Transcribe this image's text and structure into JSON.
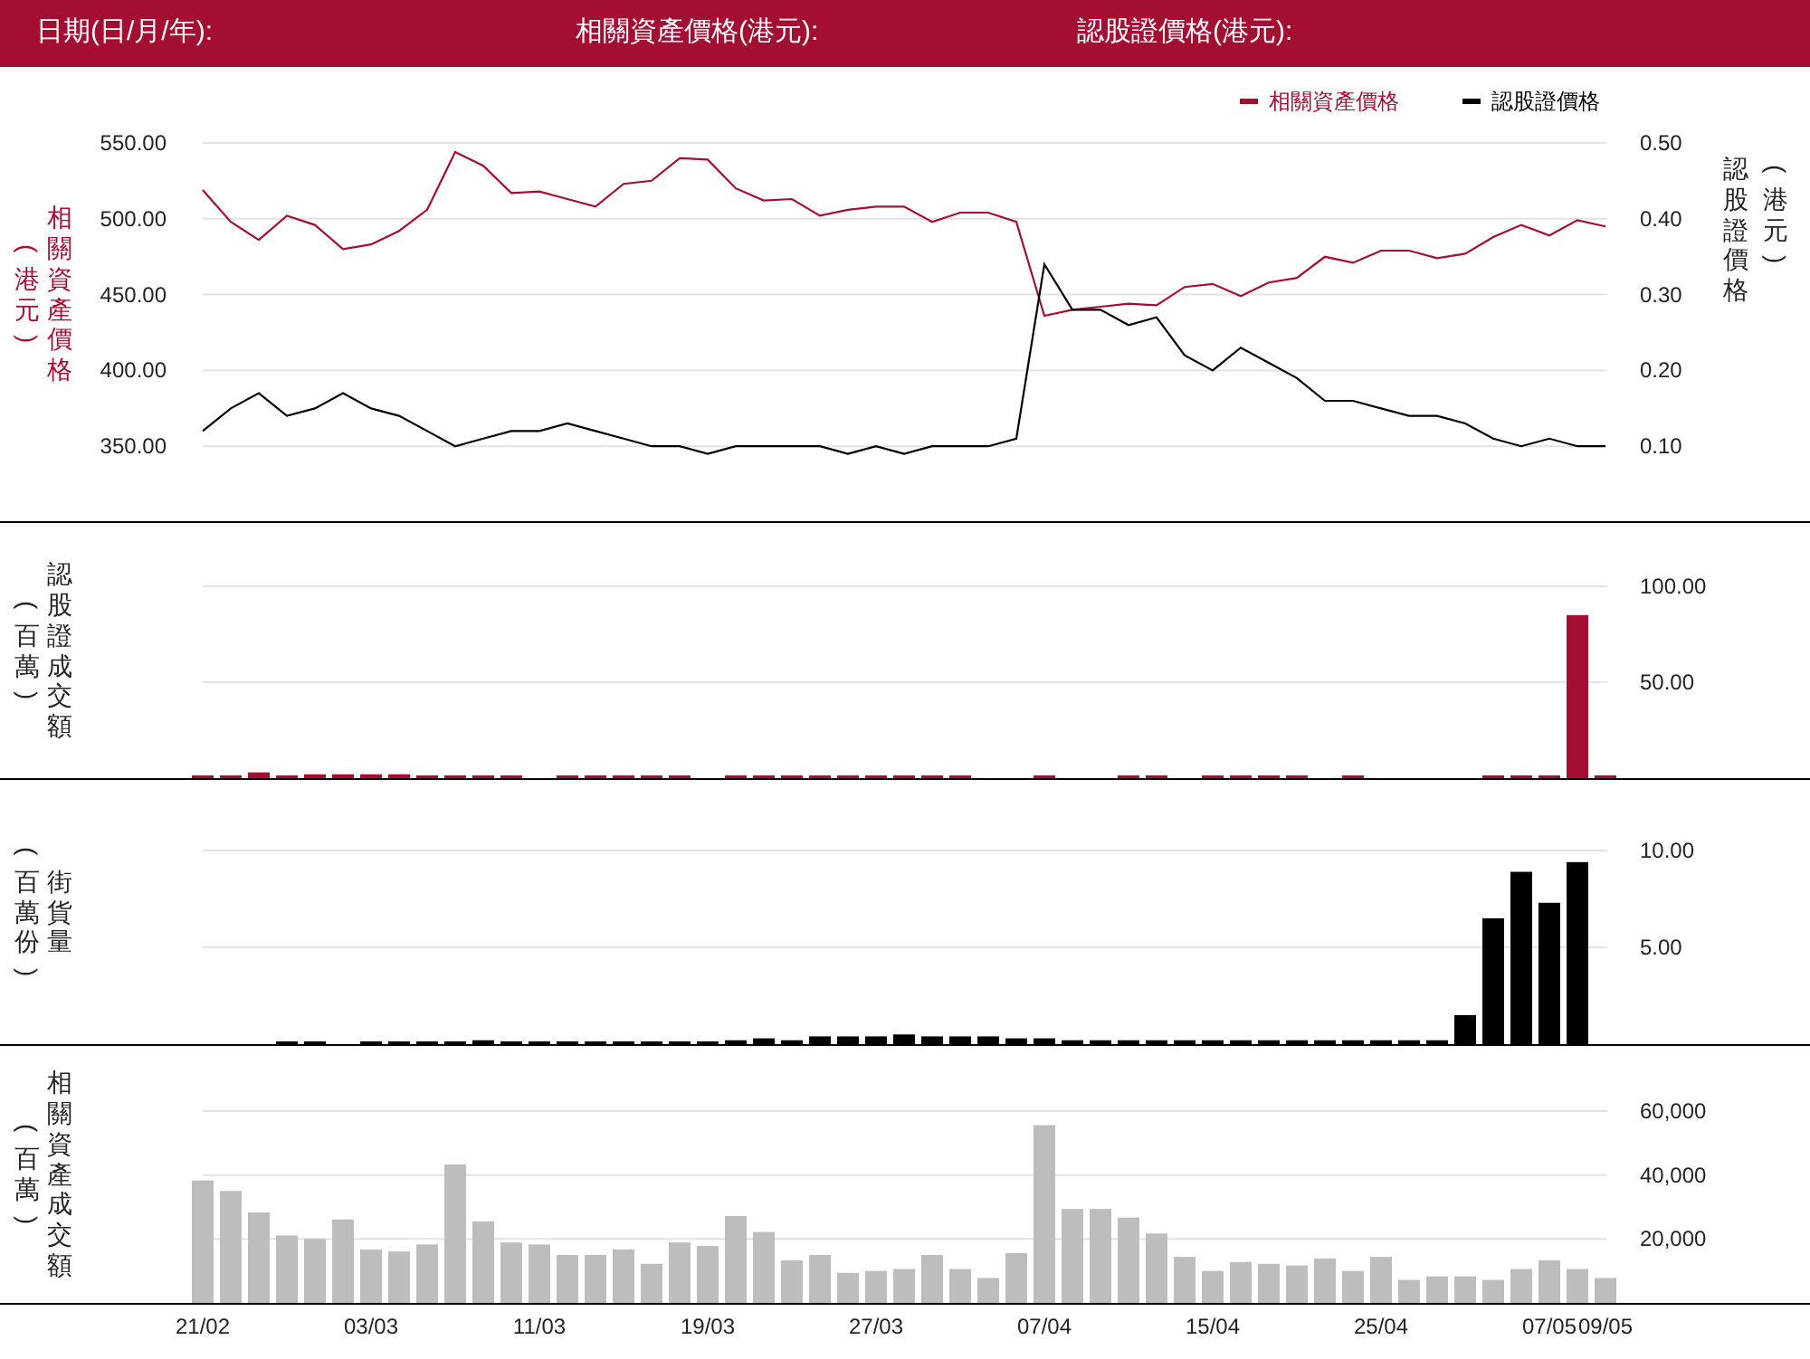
{
  "header": {
    "fields": [
      "日期(日/月/年):",
      "相關資產價格(港元):",
      "認股證價格(港元):"
    ]
  },
  "price_panel": {
    "left_unit": "(港元)",
    "right_axis_title": "認股證價格",
    "right_unit": "(港元)",
    "underlying_chart": {
      "chart_data": {
        "type": "line",
        "ylabel": "相關資產價格",
        "grid": true,
        "ylim": [
          300,
          550
        ],
        "legend": "top-right",
        "yticks": [
          {
            "value": 550,
            "label": "550.00"
          },
          {
            "value": 500,
            "label": "500.00"
          },
          {
            "value": 450,
            "label": "450.00"
          },
          {
            "value": 400,
            "label": "400.00"
          },
          {
            "value": 350,
            "label": "350.00"
          }
        ],
        "series": [
          {
            "name": "相關資產價格",
            "color": "#a50e33",
            "values": [
              519,
              498,
              486,
              502,
              496,
              480,
              483,
              492,
              506,
              544,
              535,
              517,
              518,
              513,
              508,
              523,
              525,
              540,
              539,
              520,
              512,
              513,
              502,
              506,
              508,
              508,
              498,
              504,
              504,
              498,
              436,
              440,
              442,
              444,
              443,
              455,
              457,
              449,
              458,
              461,
              475,
              471,
              479,
              479,
              474,
              477,
              488,
              496,
              489,
              499,
              495
            ]
          }
        ]
      }
    },
    "warrant_chart": {
      "chart_data": {
        "type": "line",
        "legend": "top-right",
        "ylim": [
          0,
          0.5
        ],
        "yticks": [
          {
            "value": 0.5,
            "label": "0.50"
          },
          {
            "value": 0.4,
            "label": "0.40"
          },
          {
            "value": 0.3,
            "label": "0.30"
          },
          {
            "value": 0.2,
            "label": "0.20"
          },
          {
            "value": 0.1,
            "label": "0.10"
          }
        ],
        "series": [
          {
            "name": "認股證價格",
            "color": "#000000",
            "values": [
              0.12,
              0.15,
              0.17,
              0.14,
              0.15,
              0.17,
              0.15,
              0.14,
              0.12,
              0.1,
              0.11,
              0.12,
              0.12,
              0.13,
              0.12,
              0.11,
              0.1,
              0.1,
              0.09,
              0.1,
              0.1,
              0.1,
              0.1,
              0.09,
              0.1,
              0.09,
              0.1,
              0.1,
              0.1,
              0.11,
              0.34,
              0.28,
              0.28,
              0.26,
              0.27,
              0.22,
              0.2,
              0.23,
              0.21,
              0.19,
              0.16,
              0.16,
              0.15,
              0.14,
              0.14,
              0.13,
              0.11,
              0.1,
              0.11,
              0.1,
              0.1
            ]
          }
        ]
      }
    }
  },
  "warrant_turnover_panel": {
    "left_unit": "(百萬)",
    "chart_data": {
      "type": "bar",
      "ylabel": "認股證成交額",
      "grid": true,
      "ylim": [
        0,
        100
      ],
      "yticks": [
        {
          "value": 100,
          "label": "100.00"
        },
        {
          "value": 50,
          "label": "50.00"
        }
      ],
      "series": [
        {
          "color": "#a50e33",
          "values": [
            1,
            1,
            3,
            1,
            2,
            2,
            2,
            2,
            1,
            1,
            1,
            1,
            null,
            1,
            1,
            1,
            1,
            1,
            null,
            1,
            1,
            1,
            1,
            1,
            1,
            1,
            1,
            1,
            null,
            null,
            1,
            null,
            null,
            1,
            1,
            null,
            1,
            1,
            1,
            1,
            null,
            1,
            null,
            null,
            null,
            null,
            1,
            1,
            1,
            85,
            1
          ]
        }
      ]
    }
  },
  "outstanding_panel": {
    "left_unit": "(百萬份)",
    "chart_data": {
      "type": "bar",
      "ylabel": "街貨量",
      "grid": true,
      "ylim": [
        0,
        10
      ],
      "yticks": [
        {
          "value": 10,
          "label": "10.00"
        },
        {
          "value": 5,
          "label": "5.00"
        }
      ],
      "series": [
        {
          "color": "#000000",
          "values": [
            null,
            null,
            null,
            0.1,
            0.1,
            null,
            0.1,
            0.1,
            0.1,
            0.1,
            0.2,
            0.1,
            0.1,
            0.1,
            0.1,
            0.1,
            0.1,
            0.1,
            0.1,
            0.2,
            0.3,
            0.2,
            0.4,
            0.4,
            0.4,
            0.5,
            0.4,
            0.4,
            0.4,
            0.3,
            0.3,
            0.2,
            0.2,
            0.2,
            0.2,
            0.2,
            0.2,
            0.2,
            0.2,
            0.2,
            0.2,
            0.2,
            0.2,
            0.2,
            0.2,
            1.5,
            6.5,
            8.9,
            7.3,
            9.4,
            null
          ]
        }
      ]
    }
  },
  "underlying_turnover_panel": {
    "left_unit": "(百萬)",
    "chart_data": {
      "type": "bar",
      "ylabel": "相關資產成交額",
      "grid": true,
      "ylim": [
        0,
        60000
      ],
      "yticks": [
        {
          "value": 60000,
          "label": "60,000"
        },
        {
          "value": 40000,
          "label": "40,000"
        },
        {
          "value": 20000,
          "label": "20,000"
        }
      ],
      "categories": [
        "21/02",
        null,
        null,
        null,
        null,
        null,
        "03/03",
        null,
        null,
        null,
        null,
        null,
        "11/03",
        null,
        null,
        null,
        null,
        null,
        "19/03",
        null,
        null,
        null,
        null,
        null,
        "27/03",
        null,
        null,
        null,
        null,
        null,
        "07/04",
        null,
        null,
        null,
        null,
        null,
        "15/04",
        null,
        null,
        null,
        null,
        null,
        "25/04",
        null,
        null,
        null,
        null,
        null,
        "07/05",
        null,
        "09/05"
      ],
      "series": [
        {
          "color": "#bdbdbd",
          "values": [
            38300,
            35000,
            28300,
            21100,
            20000,
            26100,
            16700,
            16100,
            18300,
            43300,
            25500,
            18900,
            18300,
            15000,
            15000,
            16700,
            12200,
            18900,
            17800,
            27200,
            22200,
            13300,
            15000,
            9400,
            10000,
            10600,
            15000,
            10600,
            7800,
            15600,
            55600,
            29400,
            29400,
            26700,
            21700,
            14400,
            10000,
            12800,
            12200,
            11700,
            13900,
            10000,
            14400,
            7200,
            8300,
            8300,
            7200,
            10600,
            13300,
            10600,
            7800
          ]
        }
      ]
    }
  }
}
